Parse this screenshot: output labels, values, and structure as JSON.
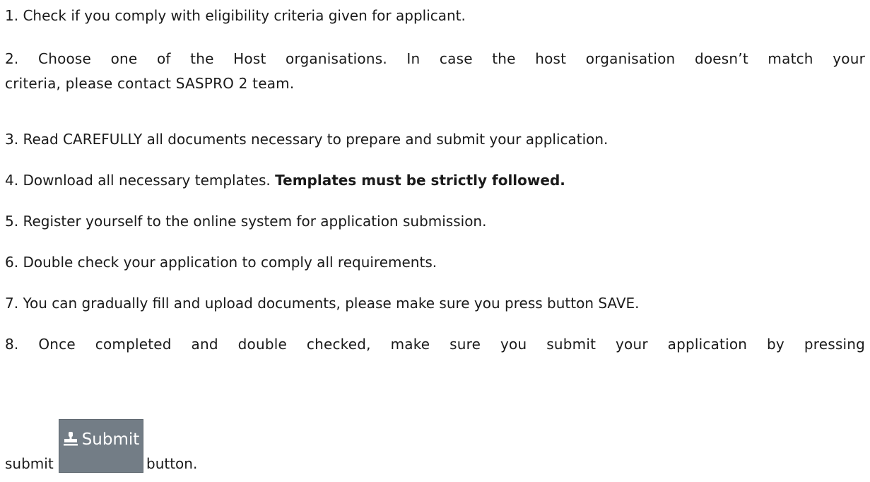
{
  "steps": [
    {
      "text": "1. Check if you comply with eligibility criteria given for applicant."
    },
    {
      "line1": "2. Choose one of the Host organisations. In case the host organisation doesn’t match your",
      "line2": "criteria, please contact SASPRO 2 team."
    },
    {
      "text": "3. Read CAREFULLY all documents necessary to prepare and submit your application."
    },
    {
      "text": "4. Download all necessary templates. ",
      "bold": "Templates must be strictly followed."
    },
    {
      "text": "5. Register yourself to the online system for application submission."
    },
    {
      "text": "6. Double check your application to comply all requirements."
    },
    {
      "text": "7. You can gradually fill and upload documents, please make sure you press button SAVE."
    },
    {
      "text": "8. Once completed and double checked, make sure you submit your application by pressing"
    }
  ],
  "submit_row": {
    "before": "submit",
    "button_label": "Submit",
    "button_icon": "stamp-icon",
    "after": "button."
  }
}
